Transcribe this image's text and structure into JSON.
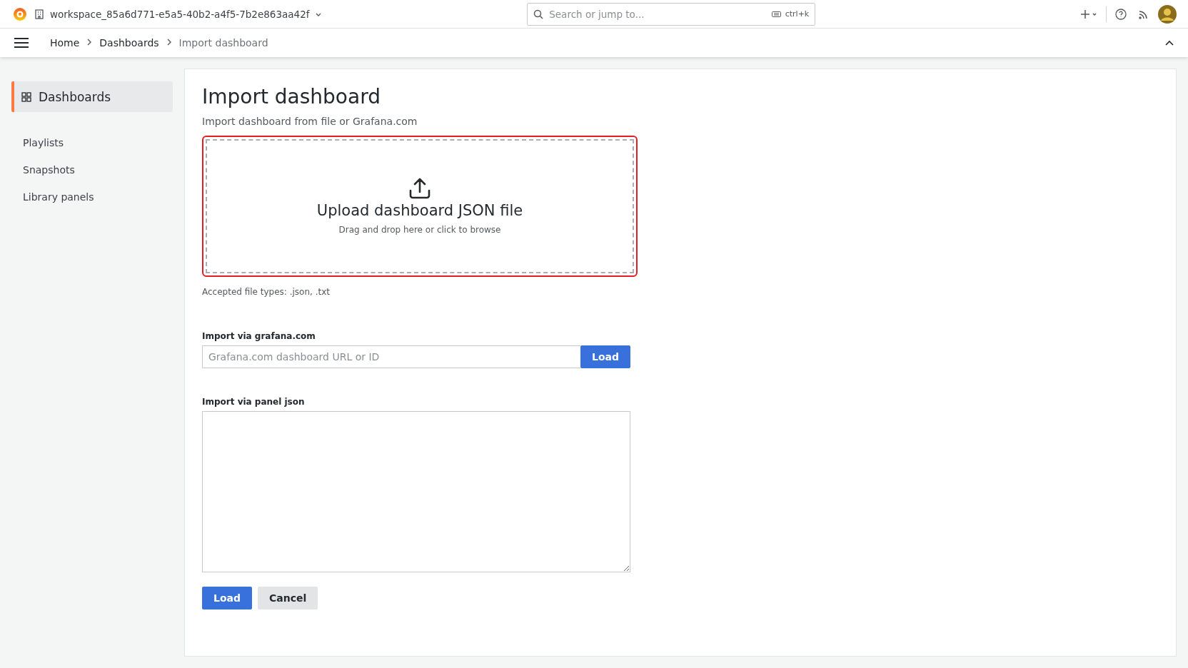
{
  "topbar": {
    "workspace": "workspace_85a6d771-e5a5-40b2-a4f5-7b2e863aa42f",
    "search": {
      "placeholder": "Search or jump to..."
    },
    "shortcut": "ctrl+k"
  },
  "breadcrumbs": [
    {
      "label": "Home",
      "current": false
    },
    {
      "label": "Dashboards",
      "current": false
    },
    {
      "label": "Import dashboard",
      "current": true
    }
  ],
  "sidebar": {
    "items": [
      {
        "label": "Dashboards",
        "selected": true
      },
      {
        "label": "Playlists",
        "selected": false
      },
      {
        "label": "Snapshots",
        "selected": false
      },
      {
        "label": "Library panels",
        "selected": false
      }
    ]
  },
  "page": {
    "title": "Import dashboard",
    "subtitle": "Import dashboard from file or Grafana.com",
    "upload": {
      "title": "Upload dashboard JSON file",
      "hint": "Drag and drop here or click to browse",
      "highlighted": true
    },
    "accepted": "Accepted file types: .json, .txt",
    "grafana_com": {
      "label": "Import via grafana.com",
      "placeholder": "Grafana.com dashboard URL or ID",
      "button": "Load"
    },
    "panel_json": {
      "label": "Import via panel json"
    },
    "buttons": [
      {
        "label": "Load",
        "kind": "primary"
      },
      {
        "label": "Cancel",
        "kind": "secondary"
      }
    ]
  }
}
